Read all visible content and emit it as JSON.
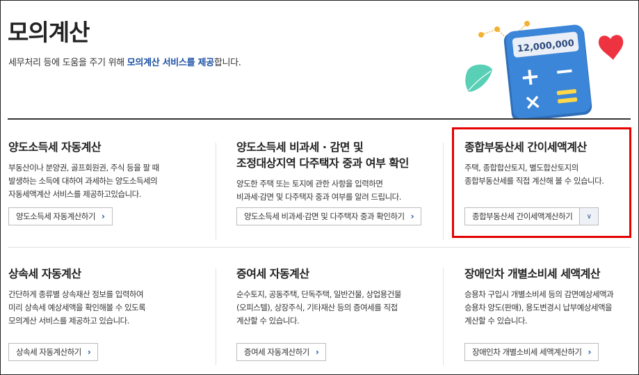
{
  "header": {
    "title": "모의계산",
    "desc_prefix": "세무처리 등에 도움을 주기 위해 ",
    "desc_highlight": "모의계산 서비스를 제공",
    "desc_suffix": "합니다."
  },
  "hero": {
    "display_value": "12,000,000",
    "plus_symbol": "+",
    "minus_symbol": "−",
    "times_symbol": "×",
    "colors": {
      "calculator": "#3b86d8",
      "screen": "#e9eef7",
      "key_accent": "#ffd84a",
      "leaf": "#3cc7a8",
      "heart": "#ee3340",
      "dots": "#f3b133"
    }
  },
  "cards": [
    {
      "title_lines": [
        "양도소득세 자동계산"
      ],
      "desc_lines": [
        "부동산이나 분양권, 골프회원권, 주식 등을 팔 때",
        "발생하는 소득에 대하여 과세하는 양도소득세의",
        "자동세액계산 서비스를 제공하고있습니다."
      ],
      "button_label": "양도소득세 자동계산하기"
    },
    {
      "title_lines": [
        "양도소득세 비과세 · 감면 및",
        "조정대상지역 다주택자 중과 여부 확인"
      ],
      "desc_lines": [
        "양도한 주택 또는 토지에 관한 사항을 입력하면",
        "비과세·감면 및 다주택자 중과 여부를 알려 드립니다."
      ],
      "button_label": "양도소득세 비과세·감면 및 다주택자 중과 확인하기"
    },
    {
      "title_lines": [
        "종합부동산세 간이세액계산"
      ],
      "desc_lines": [
        "주택, 종합합산토지, 별도합산토지의",
        "종합부동산세를 직접 계산해 볼 수 있습니다."
      ],
      "button_label": "종합부동산세 간이세액계산하기"
    },
    {
      "title_lines": [
        "상속세 자동계산"
      ],
      "desc_lines": [
        "간단하게 종류별 상속재산 정보를 입력하여",
        "미리 상속세 예상세액을 확인해볼 수 있도록",
        "모의계산 서비스를 제공하고 있습니다."
      ],
      "button_label": "상속세 자동계산하기"
    },
    {
      "title_lines": [
        "증여세 자동계산"
      ],
      "desc_lines": [
        "순수토지, 공동주택, 단독주택, 일반건물, 상업용건물",
        "(오피스텔), 상장주식, 기타재산 등의 증여세를 직접",
        "계산할 수 있습니다."
      ],
      "button_label": "증여세 자동계산하기"
    },
    {
      "title_lines": [
        "장애인차 개별소비세 세액계산"
      ],
      "desc_lines": [
        "승용차 구입시 개별소비세 등의 감면예상세액과",
        "승용차 양도(판매), 용도변경시 납부예상세액을",
        "계산할 수 있습니다."
      ],
      "button_label": "장애인차 개별소비세 세액계산하기"
    }
  ],
  "icons": {
    "chevron_right": "›",
    "chevron_down": "∨"
  },
  "colors": {
    "highlight": "#1a4fa3",
    "annotation_box": "#e60000",
    "rule": "#333333"
  }
}
